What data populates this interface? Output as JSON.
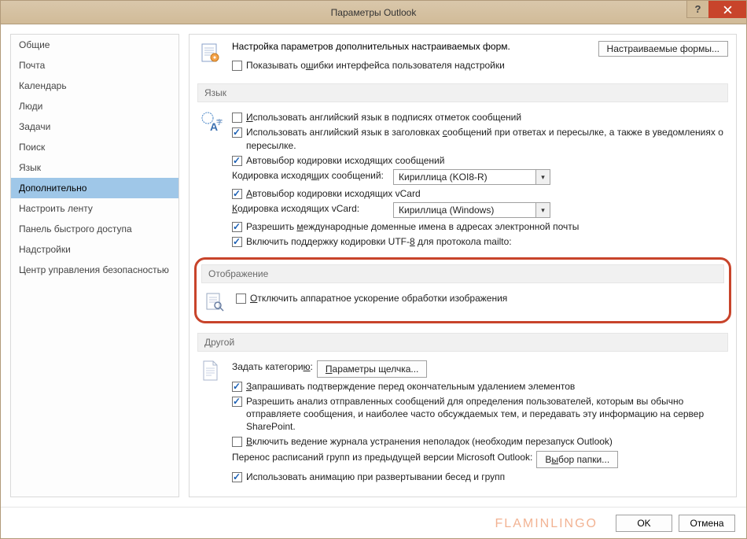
{
  "window_title": "Параметры Outlook",
  "sidebar": {
    "items": [
      "Общие",
      "Почта",
      "Календарь",
      "Люди",
      "Задачи",
      "Поиск",
      "Язык",
      "Дополнительно",
      "Настроить ленту",
      "Панель быстрого доступа",
      "Надстройки",
      "Центр управления безопасностью"
    ],
    "selected_index": 7
  },
  "forms": {
    "desc": "Настройка параметров дополнительных настраиваемых форм.",
    "button": "Настраиваемые формы...",
    "show_errors": "Показывать ошибки интерфейса пользователя надстройки"
  },
  "groups": {
    "language": "Язык",
    "display": "Отображение",
    "other": "Другой"
  },
  "language": {
    "english_flags": "Использовать английский язык в подписях отметок сообщений",
    "english_headers": "Использовать английский язык в заголовках сообщений при ответах и пересылке, а также в уведомлениях о пересылке.",
    "autoselect_outgoing": "Автовыбор кодировки исходящих сообщений",
    "encoding_label": "Кодировка исходящих сообщений:",
    "encoding_value": "Кириллица (KOI8-R)",
    "autoselect_vcard": "Автовыбор кодировки исходящих vCard",
    "vcard_encoding_label": "Кодировка исходящих vCard:",
    "vcard_encoding_value": "Кириллица (Windows)",
    "idn": "Разрешить международные доменные имена в адресах электронной почты",
    "utf8_mailto": "Включить поддержку кодировки UTF-8 для протокола mailto:"
  },
  "display": {
    "disable_hw": "Отключить аппаратное ускорение обработки изображения"
  },
  "other": {
    "set_category_label": "Задать категорию:",
    "click_params_btn": "Параметры щелчка...",
    "confirm_delete": "Запрашивать подтверждение перед окончательным удалением элементов",
    "analyze_sent": "Разрешить анализ отправленных сообщений для определения пользователей, которым вы обычно отправляете сообщения, и наиболее часто обсуждаемых тем, и передавать эту информацию на сервер SharePoint.",
    "enable_logging": "Включить ведение журнала устранения неполадок (необходим перезапуск Outlook)",
    "migrate_label": "Перенос расписаний групп из предыдущей версии Microsoft Outlook:",
    "select_folder_btn": "Выбор папки...",
    "animate_expand": "Использовать анимацию при развертывании бесед и групп"
  },
  "footer": {
    "ok": "OK",
    "cancel": "Отмена"
  },
  "watermark": "FLAMINLINGO"
}
